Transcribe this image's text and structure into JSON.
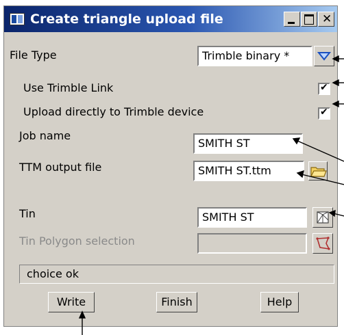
{
  "window": {
    "title": "Create triangle upload file"
  },
  "file_type": {
    "label": "File Type",
    "value": "Trimble binary *"
  },
  "use_trimble_link": {
    "label": "Use Trimble Link",
    "checked": true
  },
  "upload_direct": {
    "label": "Upload directly to Trimble device",
    "checked": true
  },
  "job_name": {
    "label": "Job name",
    "value": "SMITH ST"
  },
  "ttm_output": {
    "label": "TTM output file",
    "value": "SMITH ST.ttm"
  },
  "tin": {
    "label": "Tin",
    "value": "SMITH ST"
  },
  "tin_polygon": {
    "label": "Tin Polygon selection",
    "value": ""
  },
  "status": {
    "text": "choice ok"
  },
  "buttons": {
    "write": "Write",
    "finish": "Finish",
    "help": "Help"
  },
  "icons": {
    "file_type_dropdown": "chevron-down-icon",
    "ttm_browse": "folder-icon",
    "tin_select": "tin-pick-icon",
    "polygon_select": "polygon-pick-icon"
  }
}
